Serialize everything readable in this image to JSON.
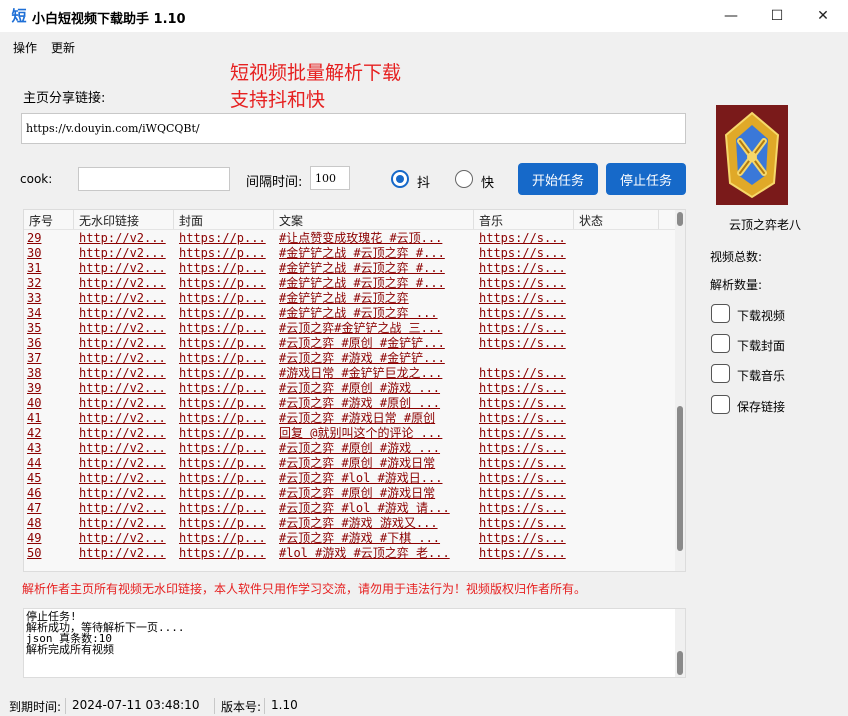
{
  "window": {
    "icon_glyph": "短",
    "title": "小白短视频下载助手 1.10",
    "minimize_glyph": "—",
    "maximize_glyph": "☐",
    "close_glyph": "✕"
  },
  "menu": [
    {
      "label": "操作"
    },
    {
      "label": "更新"
    }
  ],
  "ad_lines": [
    "短视频批量解析下载",
    "支持抖和快"
  ],
  "form": {
    "share_label": "主页分享链接:",
    "share_value": "https://v.douyin.com/iWQCQBt/",
    "cook_label": "cook:",
    "cook_value": "",
    "interval_label": "间隔时间:",
    "interval_value": "100",
    "radio_douyin_label": "抖",
    "radio_kuaishou_label": "快",
    "selected_platform": "抖",
    "start_button": "开始任务",
    "stop_button": "停止任务"
  },
  "table": {
    "columns": [
      "序号",
      "无水印链接",
      "封面",
      "文案",
      "音乐",
      "状态"
    ],
    "rows": [
      {
        "id": "29",
        "video": "http://v2...",
        "cover": "https://p...",
        "text": "#让点赞变成玫瑰花 #云顶...",
        "music": "https://s..."
      },
      {
        "id": "30",
        "video": "http://v2...",
        "cover": "https://p...",
        "text": "#金铲铲之战 #云顶之弈 #...",
        "music": "https://s..."
      },
      {
        "id": "31",
        "video": "http://v2...",
        "cover": "https://p...",
        "text": "#金铲铲之战 #云顶之弈 #...",
        "music": "https://s..."
      },
      {
        "id": "32",
        "video": "http://v2...",
        "cover": "https://p...",
        "text": "#金铲铲之战 #云顶之弈 #...",
        "music": "https://s..."
      },
      {
        "id": "33",
        "video": "http://v2...",
        "cover": "https://p...",
        "text": "#金铲铲之战 #云顶之弈",
        "music": "https://s..."
      },
      {
        "id": "34",
        "video": "http://v2...",
        "cover": "https://p...",
        "text": "#金铲铲之战 #云顶之弈 ...",
        "music": "https://s..."
      },
      {
        "id": "35",
        "video": "http://v2...",
        "cover": "https://p...",
        "text": "#云顶之弈#金铲铲之战 三...",
        "music": "https://s..."
      },
      {
        "id": "36",
        "video": "http://v2...",
        "cover": "https://p...",
        "text": "#云顶之弈 #原创 #金铲铲...",
        "music": "https://s..."
      },
      {
        "id": "37",
        "video": "http://v2...",
        "cover": "https://p...",
        "text": "#云顶之弈 #游戏 #金铲铲...",
        "music": ""
      },
      {
        "id": "38",
        "video": "http://v2...",
        "cover": "https://p...",
        "text": "#游戏日常 #金铲铲巨龙之...",
        "music": "https://s..."
      },
      {
        "id": "39",
        "video": "http://v2...",
        "cover": "https://p...",
        "text": "#云顶之弈 #原创 #游戏 ...",
        "music": "https://s..."
      },
      {
        "id": "40",
        "video": "http://v2...",
        "cover": "https://p...",
        "text": "#云顶之弈 #游戏 #原创 ...",
        "music": "https://s..."
      },
      {
        "id": "41",
        "video": "http://v2...",
        "cover": "https://p...",
        "text": "#云顶之弈 #游戏日常 #原创",
        "music": "https://s..."
      },
      {
        "id": "42",
        "video": "http://v2...",
        "cover": "https://p...",
        "text": "回复 @就别叫这个的评论 ...",
        "music": "https://s..."
      },
      {
        "id": "43",
        "video": "http://v2...",
        "cover": "https://p...",
        "text": "#云顶之弈 #原创 #游戏 ...",
        "music": "https://s..."
      },
      {
        "id": "44",
        "video": "http://v2...",
        "cover": "https://p...",
        "text": "#云顶之弈 #原创 #游戏日常",
        "music": "https://s..."
      },
      {
        "id": "45",
        "video": "http://v2...",
        "cover": "https://p...",
        "text": "#云顶之弈 #lol #游戏日...",
        "music": "https://s..."
      },
      {
        "id": "46",
        "video": "http://v2...",
        "cover": "https://p...",
        "text": "#云顶之弈 #原创 #游戏日常",
        "music": "https://s..."
      },
      {
        "id": "47",
        "video": "http://v2...",
        "cover": "https://p...",
        "text": "#云顶之弈 #lol #游戏 请...",
        "music": "https://s..."
      },
      {
        "id": "48",
        "video": "http://v2...",
        "cover": "https://p...",
        "text": "#云顶之弈 #游戏 游戏又...",
        "music": "https://s..."
      },
      {
        "id": "49",
        "video": "http://v2...",
        "cover": "https://p...",
        "text": "#云顶之弈 #游戏 #下棋 ...",
        "music": "https://s..."
      },
      {
        "id": "50",
        "video": "http://v2...",
        "cover": "https://p...",
        "text": "#lol #游戏 #云顶之弈 老...",
        "music": "https://s..."
      }
    ]
  },
  "notice": "解析作者主页所有视频无水印链接，本人软件只用作学习交流，请勿用于违法行为！视频版权归作者所有。",
  "log_lines": [
    "停止任务!",
    "解析成功，等待解析下一页....",
    "json 真条数:10",
    "解析完成所有视频"
  ],
  "sidebar": {
    "author_name": "云顶之弈老八",
    "total_videos_label": "视频总数:",
    "parsed_count_label": "解析数量:",
    "checkboxes": [
      {
        "label": "下载视频"
      },
      {
        "label": "下载封面"
      },
      {
        "label": "下载音乐"
      },
      {
        "label": "保存链接"
      }
    ]
  },
  "statusbar": {
    "expiry_label": "到期时间:",
    "expiry_value": "2024-07-11 03:48:10",
    "version_label": "版本号:",
    "version_value": "1.10"
  },
  "colors": {
    "accent": "#1669c9",
    "warning_text": "#e62020",
    "link_text": "#8b0000"
  }
}
